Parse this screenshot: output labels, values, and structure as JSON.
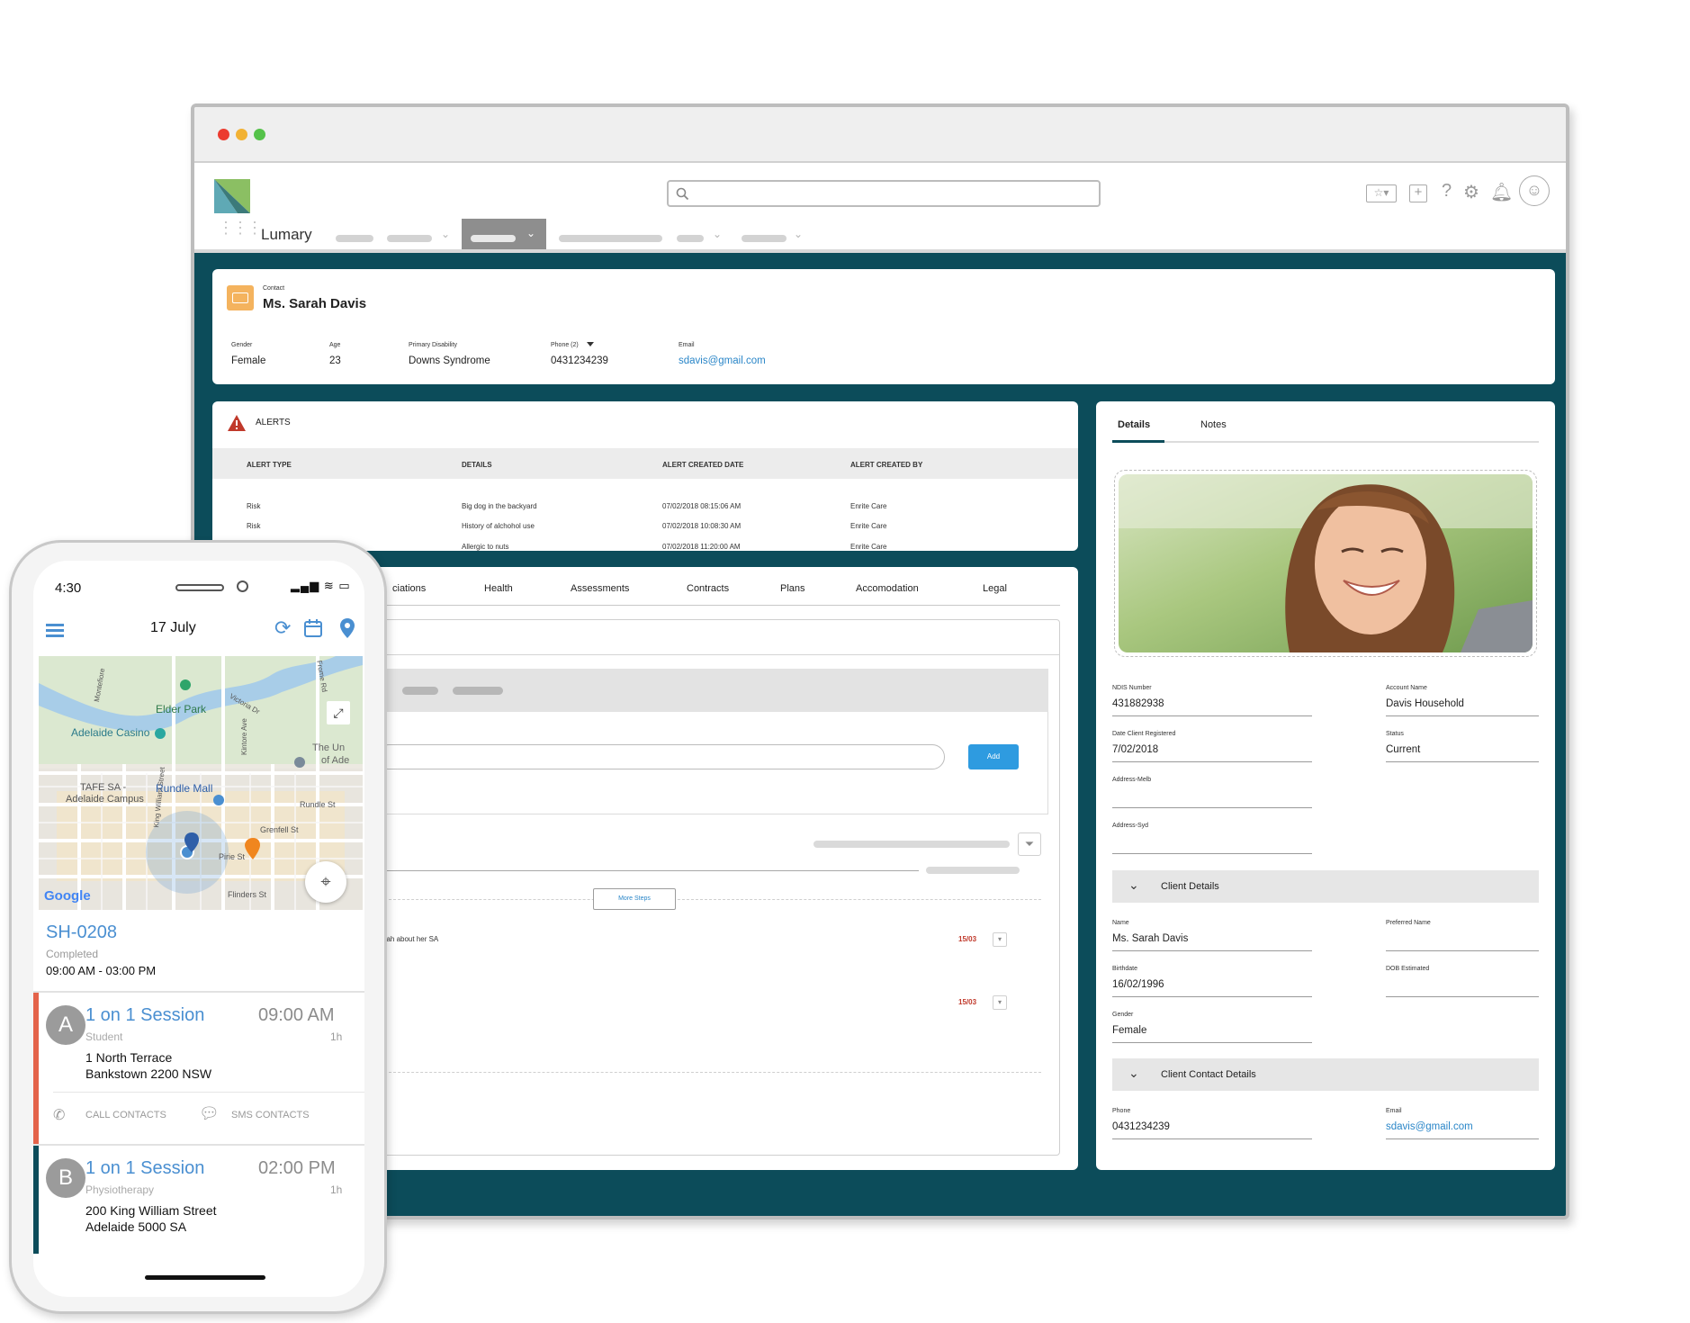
{
  "browser": {
    "app_name": "Lumary",
    "search_placeholder": ""
  },
  "contact": {
    "type_label": "Contact",
    "name": "Ms. Sarah Davis",
    "fields": {
      "gender_label": "Gender",
      "gender": "Female",
      "age_label": "Age",
      "age": "23",
      "disability_label": "Primary Disability",
      "disability": "Downs Syndrome",
      "phone_label": "Phone (2)",
      "phone": "0431234239",
      "email_label": "Email",
      "email": "sdavis@gmail.com"
    }
  },
  "alerts": {
    "title": "ALERTS",
    "headers": [
      "ALERT TYPE",
      "DETAILS",
      "ALERT CREATED DATE",
      "ALERT CREATED BY"
    ],
    "rows": [
      {
        "type": "Risk",
        "details": "Big dog in the backyard",
        "date": "07/02/2018 08:15:06 AM",
        "by": "Enrite Care"
      },
      {
        "type": "Risk",
        "details": "History of alchohol use",
        "date": "07/02/2018 10:08:30 AM",
        "by": "Enrite Care"
      },
      {
        "type": "",
        "details": "Allergic to nuts",
        "date": "07/02/2018 11:20:00 AM",
        "by": "Enrite Care"
      }
    ]
  },
  "mid_tabs": [
    "ciations",
    "Health",
    "Assessments",
    "Contracts",
    "Plans",
    "Accomodation",
    "Legal"
  ],
  "activity": {
    "add_label": "Add",
    "more_steps_label": "More Steps",
    "item_link": "Sarah about her SA",
    "dates": [
      "15/03",
      "15/03"
    ]
  },
  "details_panel": {
    "tabs": [
      "Details",
      "Notes"
    ],
    "ndis_label": "NDIS Number",
    "ndis": "431882938",
    "account_label": "Account Name",
    "account": "Davis Household",
    "registered_label": "Date Client Registered",
    "registered": "7/02/2018",
    "status_label": "Status",
    "status": "Current",
    "address_m_label": "Address-Melb",
    "address_s_label": "Address-Syd",
    "client_details_header": "Client Details",
    "name_label": "Name",
    "name": "Ms. Sarah Davis",
    "preferred_label": "Preferred Name",
    "birthdate_label": "Birthdate",
    "birthdate": "16/02/1996",
    "dob_est_label": "DOB Estimated",
    "gender_label": "Gender",
    "gender": "Female",
    "contact_details_header": "Client Contact Details",
    "phone_label": "Phone",
    "phone": "0431234239",
    "email_label": "Email",
    "email": "sdavis@gmail.com"
  },
  "phone": {
    "time": "4:30",
    "date": "17 July",
    "map": {
      "labels": [
        "Elder Park",
        "Adelaide Casino",
        "TAFE SA -",
        "Adelaide Campus",
        "Rundle Mall",
        "The Un",
        "of Ade",
        "Rundle St",
        "Grenfell St",
        "Pirie St",
        "Flinders St",
        "King William Street",
        "Victoria Dr",
        "Montefiore",
        "Kintore Ave",
        "Frome Rd",
        "Google"
      ]
    },
    "shift": {
      "id": "SH-0208",
      "status": "Completed",
      "time_range": "09:00 AM - 03:00 PM"
    },
    "sessions": [
      {
        "initial": "A",
        "title": "1 on 1 Session",
        "time": "09:00 AM",
        "subtitle": "Student",
        "duration": "1h",
        "address1": "1 North Terrace",
        "address2": "Bankstown 2200 NSW",
        "accent": "#e4634a"
      },
      {
        "initial": "B",
        "title": "1 on 1 Session",
        "time": "02:00 PM",
        "subtitle": "Physiotherapy",
        "duration": "1h",
        "address1": "200 King William Street",
        "address2": "Adelaide 5000 SA",
        "accent": "#0c4c5a"
      }
    ],
    "call_contacts": "CALL CONTACTS",
    "sms_contacts": "SMS CONTACTS"
  }
}
